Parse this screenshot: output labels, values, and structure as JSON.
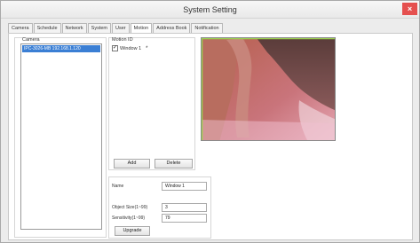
{
  "window": {
    "title": "System Setting",
    "close_label": "×"
  },
  "tabs": [
    {
      "label": "Camera"
    },
    {
      "label": "Schedule"
    },
    {
      "label": "Network"
    },
    {
      "label": "System"
    },
    {
      "label": "User"
    },
    {
      "label": "Motion"
    },
    {
      "label": "Address Book"
    },
    {
      "label": "Notification"
    }
  ],
  "active_tab": "Motion",
  "camera_panel": {
    "label": "Camera",
    "items": [
      "IPC-3026-MB 192.168.1.120"
    ]
  },
  "motion_panel": {
    "label": "Motion ID",
    "items": [
      {
        "label": "Window 1",
        "checked": true,
        "mark": "*"
      }
    ],
    "checkbox_glyph": "✓",
    "add_label": "Add",
    "delete_label": "Delete"
  },
  "settings": {
    "name_label": "Name",
    "name_value": "Window 1",
    "object_size_label": "Object Size(1~99)",
    "object_size_value": "3",
    "sensitivity_label": "Sensitivity(1~99)",
    "sensitivity_value": "79",
    "upgrade_label": "Upgrade"
  },
  "colors": {
    "selection": "#3b7fd4",
    "close_button": "#e5504f",
    "motion_window_border": "#9bd14f"
  }
}
